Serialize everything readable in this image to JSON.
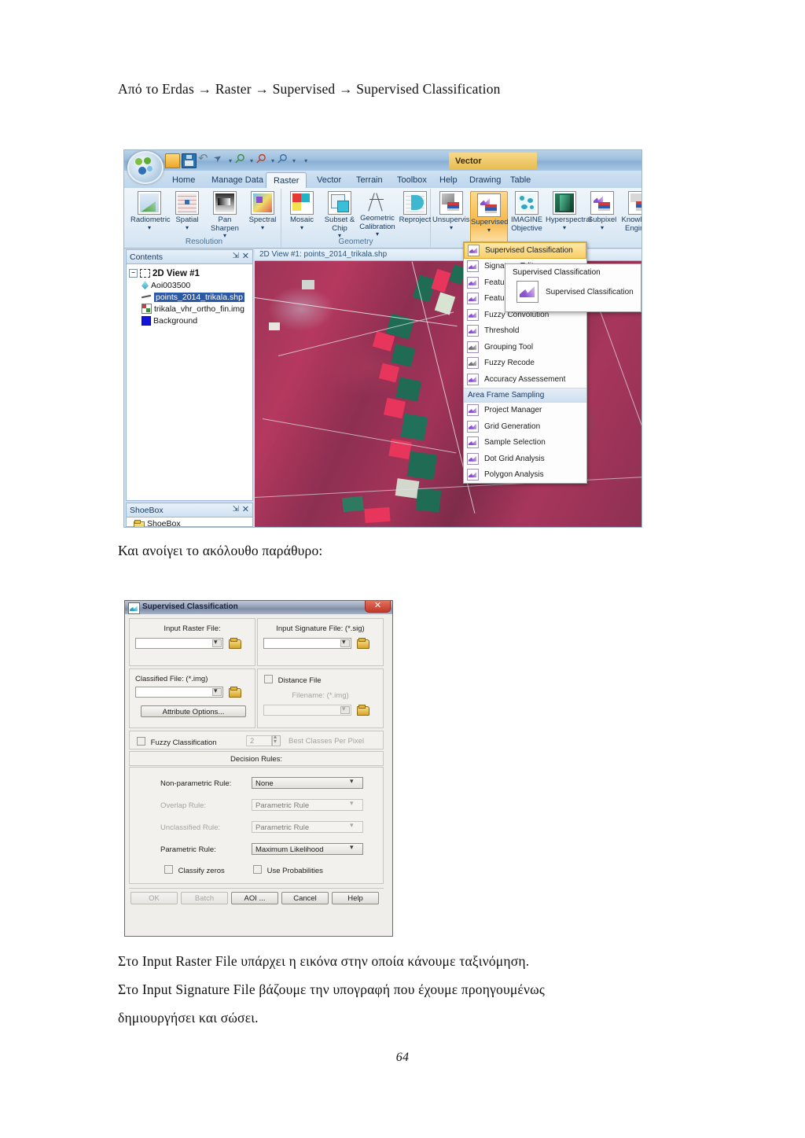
{
  "document": {
    "intro_line": "Από το Erdas → Raster → Supervised → Supervised Classification",
    "mid_line": "Και ανοίγει το ακόλουθο παράθυρο:",
    "para1": "Στο Input Raster File υπάρχει η εικόνα στην οποία κάνουμε ταξινόμηση.",
    "para2": "Στο Input Signature File βάζουμε την υπογραφή που έχουμε προηγουμένως",
    "para3": "δημιουργήσει και σώσει.",
    "page_number": "64"
  },
  "erdas": {
    "contextual_tab": "Vector",
    "quick_access": [
      "open-icon",
      "save-icon",
      "undo-icon",
      "cursor-icon",
      "zoom-green-icon",
      "zoom-red-icon",
      "zoom-blue-icon",
      "more-icon"
    ],
    "tabs": [
      {
        "label": "Home",
        "active": false
      },
      {
        "label": "Manage Data",
        "active": false
      },
      {
        "label": "Raster",
        "active": true
      },
      {
        "label": "Vector",
        "active": false
      },
      {
        "label": "Terrain",
        "active": false
      },
      {
        "label": "Toolbox",
        "active": false
      },
      {
        "label": "Help",
        "active": false
      },
      {
        "label": "Drawing",
        "active": false
      },
      {
        "label": "Table",
        "active": false
      }
    ],
    "groups": [
      {
        "label": "Resolution",
        "buttons": [
          {
            "label": "Radiometric",
            "caret": "▾",
            "icon": "radiometric-icon"
          },
          {
            "label": "Spatial",
            "caret": "▾",
            "icon": "spatial-icon"
          },
          {
            "label": "Pan Sharpen",
            "caret": "▾",
            "icon": "pan-sharpen-icon"
          },
          {
            "label": "Spectral",
            "caret": "▾",
            "icon": "spectral-icon"
          }
        ]
      },
      {
        "label": "Geometry",
        "buttons": [
          {
            "label": "Mosaic",
            "caret": "▾",
            "icon": "mosaic-icon"
          },
          {
            "label": "Subset & Chip",
            "caret": "▾",
            "icon": "subset-chip-icon"
          },
          {
            "label": "Geometric Calibration",
            "caret": "▾",
            "icon": "geometric-calibration-icon"
          },
          {
            "label": "Reproject",
            "caret": "",
            "icon": "reproject-icon"
          }
        ]
      },
      {
        "label": "",
        "buttons": [
          {
            "label": "Unsupervised",
            "caret": "▾",
            "icon": "unsupervised-icon"
          },
          {
            "label": "Supervised",
            "caret": "▾",
            "icon": "supervised-icon"
          },
          {
            "label": "IMAGINE Objective",
            "caret": "",
            "icon": "imagine-objective-icon"
          },
          {
            "label": "Hyperspectral",
            "caret": "▾",
            "icon": "hyperspectral-icon"
          },
          {
            "label": "Subpixel",
            "caret": "▾",
            "icon": "subpixel-icon"
          },
          {
            "label": "Knowledge Engineer",
            "caret": "",
            "icon": "knowledge-engineer-icon"
          }
        ]
      }
    ],
    "contents_panel": {
      "title": "Contents",
      "root": "2D View #1",
      "items": [
        {
          "label": "Aoi003500",
          "selected": false
        },
        {
          "label": "points_2014_trikala.shp",
          "selected": true
        },
        {
          "label": "trikala_vhr_ortho_fin.img",
          "selected": false
        },
        {
          "label": "Background",
          "selected": false
        }
      ]
    },
    "shoebox_panel": {
      "title": "ShoeBox",
      "item": "ShoeBox"
    },
    "view_tab_label": "2D View #1: points_2014_trikala.shp",
    "dropdown_menu": {
      "items": [
        {
          "label": "Supervised Classification",
          "highlighted": true,
          "style": "purple"
        },
        {
          "label": "Signature Editor",
          "highlighted": false,
          "style": "purple"
        },
        {
          "label": "Feature Space Image",
          "highlighted": false,
          "style": "purple"
        },
        {
          "label": "Feature Space Tools",
          "highlighted": false,
          "style": "purple"
        },
        {
          "label": "Fuzzy Convolution",
          "highlighted": false,
          "style": "purple"
        },
        {
          "label": "Threshold",
          "highlighted": false,
          "style": "purple"
        },
        {
          "label": "Grouping Tool",
          "highlighted": false,
          "style": "gray"
        },
        {
          "label": "Fuzzy Recode",
          "highlighted": false,
          "style": "gray"
        },
        {
          "label": "Accuracy Assessement",
          "highlighted": false,
          "style": "purple"
        }
      ],
      "section_label": "Area Frame Sampling",
      "section_items": [
        {
          "label": "Project Manager",
          "style": "purple"
        },
        {
          "label": "Grid Generation",
          "style": "purple"
        },
        {
          "label": "Sample Selection",
          "style": "purple"
        },
        {
          "label": "Dot Grid Analysis",
          "style": "purple"
        },
        {
          "label": "Polygon Analysis",
          "style": "purple"
        }
      ]
    },
    "tooltip": {
      "title": "Supervised Classification",
      "body": "Supervised Classification"
    }
  },
  "dialog": {
    "title": "Supervised Classification",
    "close_label": "✕",
    "input_raster_label": "Input Raster File:",
    "input_raster_value": "",
    "input_signature_label": "Input Signature File: (*.sig)",
    "input_signature_value": "",
    "classified_file_label": "Classified File: (*.img)",
    "classified_file_value": "",
    "attribute_options_label": "Attribute Options...",
    "distance_file_label": "Distance File",
    "distance_filename_label": "Filename: (*.img)",
    "distance_filename_value": "",
    "fuzzy_classification_label": "Fuzzy Classification",
    "fuzzy_count_value": "2",
    "best_classes_label": "Best Classes Per Pixel",
    "decision_rules_label": "Decision Rules:",
    "rules": [
      {
        "label": "Non-parametric Rule:",
        "value": "None",
        "disabled": false
      },
      {
        "label": "Overlap Rule:",
        "value": "Parametric Rule",
        "disabled": true
      },
      {
        "label": "Unclassified Rule:",
        "value": "Parametric Rule",
        "disabled": true
      },
      {
        "label": "Parametric Rule:",
        "value": "Maximum Likelihood",
        "disabled": false
      }
    ],
    "classify_zeros_label": "Classify zeros",
    "use_probabilities_label": "Use Probabilities",
    "buttons": [
      {
        "label": "OK",
        "disabled": true
      },
      {
        "label": "Batch",
        "disabled": true
      },
      {
        "label": "AOI ...",
        "disabled": false
      },
      {
        "label": "Cancel",
        "disabled": false
      },
      {
        "label": "Help",
        "disabled": false
      }
    ]
  },
  "colors": {
    "accent_orange": "#f7b94a",
    "menu_highlight": "#f8cf6a",
    "selection_blue": "#2c59a6",
    "close_red": "#c0392b",
    "ribbon_blue": "#cfe1f2"
  }
}
